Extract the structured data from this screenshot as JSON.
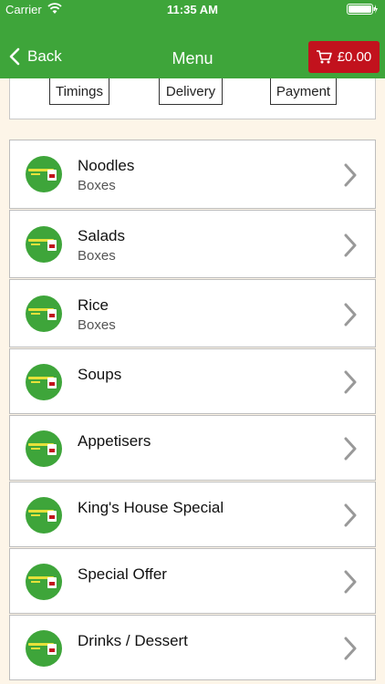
{
  "status": {
    "carrier": "Carrier",
    "time": "11:35 AM"
  },
  "nav": {
    "back_label": "Back",
    "title": "Menu",
    "cart_total": "£0.00"
  },
  "info_buttons": [
    "Timings",
    "Delivery",
    "Payment"
  ],
  "items": [
    {
      "title": "Noodles",
      "subtitle": "Boxes"
    },
    {
      "title": "Salads",
      "subtitle": "Boxes"
    },
    {
      "title": "Rice",
      "subtitle": "Boxes"
    },
    {
      "title": "Soups",
      "subtitle": ""
    },
    {
      "title": "Appetisers",
      "subtitle": ""
    },
    {
      "title": "King's House Special",
      "subtitle": ""
    },
    {
      "title": "Special Offer",
      "subtitle": ""
    },
    {
      "title": "Drinks / Dessert",
      "subtitle": ""
    }
  ],
  "colors": {
    "brand_green": "#3ea53a",
    "cart_red": "#c2121d",
    "background": "#fdf5e8"
  }
}
